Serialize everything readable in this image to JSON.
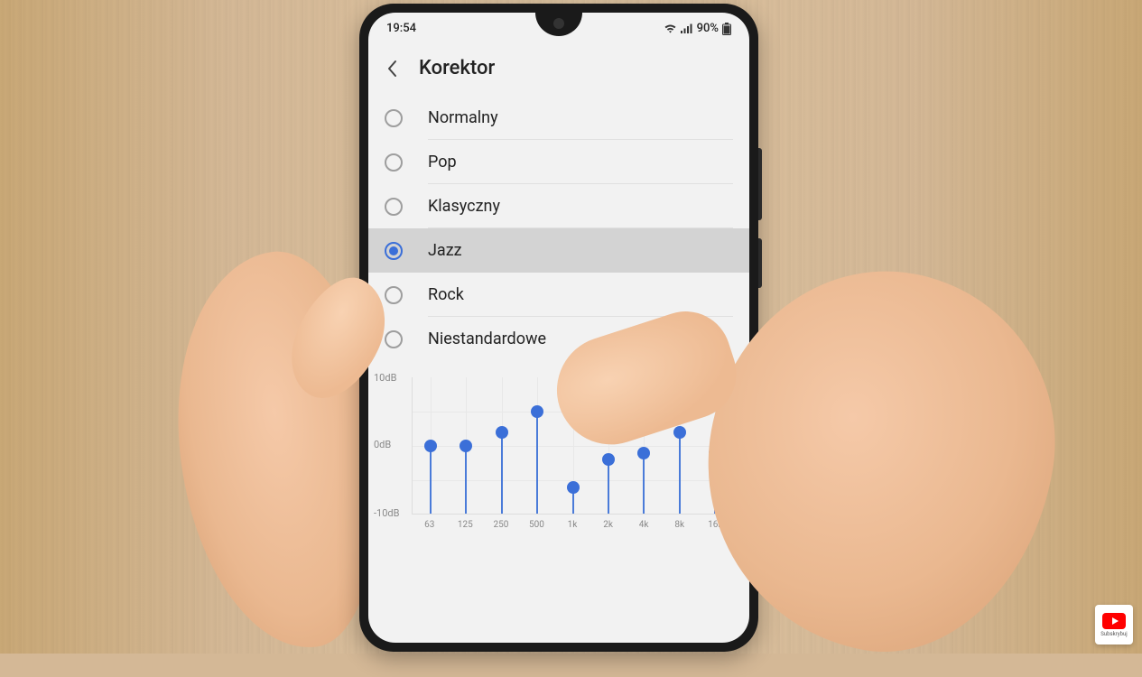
{
  "status": {
    "time": "19:54",
    "battery_pct": "90%"
  },
  "header": {
    "title": "Korektor"
  },
  "options": [
    {
      "label": "Normalny",
      "selected": false
    },
    {
      "label": "Pop",
      "selected": false
    },
    {
      "label": "Klasyczny",
      "selected": false
    },
    {
      "label": "Jazz",
      "selected": true
    },
    {
      "label": "Rock",
      "selected": false
    },
    {
      "label": "Niestandardowe",
      "selected": false
    }
  ],
  "chart_data": {
    "type": "bar",
    "title": "",
    "xlabel": "",
    "ylabel": "",
    "ylim": [
      -10,
      10
    ],
    "ytick_labels": [
      "10dB",
      "0dB",
      "-10dB"
    ],
    "categories": [
      "63",
      "125",
      "250",
      "500",
      "1k",
      "2k",
      "4k",
      "8k",
      "16k"
    ],
    "values": [
      0,
      0,
      2,
      5,
      -6,
      -2,
      -1,
      2,
      -1
    ]
  },
  "overlay": {
    "subscribe_label": "Subskrybuj"
  }
}
